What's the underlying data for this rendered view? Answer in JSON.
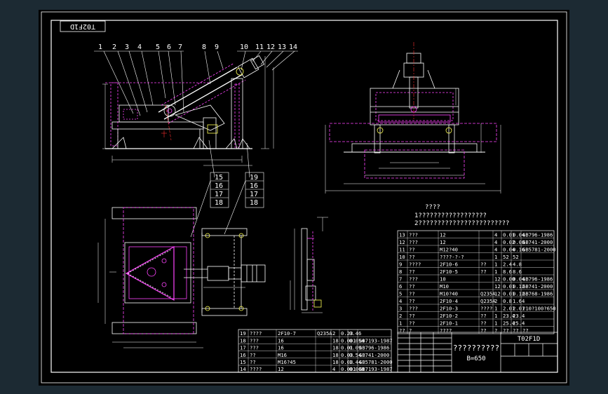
{
  "drawing": {
    "frame_code": "T02F1D",
    "drawing_code": "T02F1D",
    "title_text": "??????????",
    "spec": "B=650",
    "notes_header": "????",
    "notes": [
      "1??????????????????",
      "2????????????????????????"
    ],
    "callouts_top": [
      "1",
      "2",
      "3",
      "4",
      "5",
      "6",
      "7",
      "8",
      "9",
      "10",
      "11",
      "12",
      "13",
      "14"
    ],
    "callouts_mid_left": [
      "15",
      "16",
      "17",
      "18"
    ],
    "callouts_mid_right": [
      "19",
      "16",
      "17",
      "18"
    ]
  },
  "bom_right": [
    [
      "13",
      "???",
      "12",
      "",
      "4",
      "0.01",
      "0.04",
      "GB796-1986"
    ],
    [
      "12",
      "???",
      "12",
      "",
      "4",
      "0.02",
      "0.08",
      "GB741-2000"
    ],
    [
      "11",
      "??",
      "M12?40",
      "",
      "4",
      "0.04",
      "0.16",
      "GB5781-2000"
    ],
    [
      "10",
      "??",
      "????-?-?",
      "",
      "1",
      "52",
      "52",
      ""
    ],
    [
      "9",
      "????",
      "2F10-6",
      "??",
      "1",
      "2.4",
      "4.8",
      ""
    ],
    [
      "8",
      "??",
      "2F10-5",
      "??",
      "1",
      "8.6",
      "8.6",
      ""
    ],
    [
      "7",
      "???",
      "10",
      "",
      "12",
      "0.00",
      "0.04",
      "GB796-1986"
    ],
    [
      "6",
      "??",
      "M10",
      "",
      "12",
      "0.01",
      "0.12",
      "GB741-2000"
    ],
    [
      "5",
      "??",
      "M10?40",
      "Q235A",
      "12",
      "0.01",
      "0.12",
      "GB768-1986"
    ],
    [
      "4",
      "??",
      "2F10-4",
      "Q235A",
      "2",
      "0.8",
      "1.64",
      ""
    ],
    [
      "3",
      "???",
      "2F10-3",
      "????",
      "1",
      "2.01",
      "2.01",
      "?10?100?650"
    ],
    [
      "2",
      "??",
      "2F10-2",
      "??",
      "1",
      "23.4",
      "23.4",
      ""
    ],
    [
      "1",
      "??",
      "2F10-1",
      "??",
      "1",
      "25.4",
      "25.4",
      ""
    ]
  ],
  "bom_right_header": [
    "??",
    "?",
    "????",
    "??",
    "?",
    "??",
    "??",
    "??"
  ],
  "bom_bottom": [
    [
      "19",
      "????",
      "2F10-7",
      "Q235A",
      "2",
      "0.23",
      "0.46",
      ""
    ],
    [
      "18",
      "???",
      "16",
      "",
      "18",
      "0.001",
      "0.054",
      "GB7193-1987"
    ],
    [
      "17",
      "???",
      "16",
      "",
      "18",
      "0.01",
      "0.09",
      "GB796-1986"
    ],
    [
      "16",
      "??",
      "M16",
      "",
      "18",
      "0.03",
      "0.54",
      "GB741-2000"
    ],
    [
      "15",
      "??",
      "M16?45",
      "",
      "18",
      "0.08",
      "1.44",
      "GB5781-2000"
    ],
    [
      "14",
      "????",
      "12",
      "",
      "4",
      "0.001",
      "0.008",
      "GB7193-1987"
    ]
  ],
  "colors": {
    "background": "#000000",
    "outer": "#1c2a33",
    "frame": "#ffffff",
    "part": "#ffffff",
    "hidden": "#ff44ff",
    "dimension": "#ffffff",
    "center": "#ff3030",
    "callout_text": "#ffffff",
    "accent_yellow": "#ffff55",
    "accent_green": "#33dd33"
  }
}
